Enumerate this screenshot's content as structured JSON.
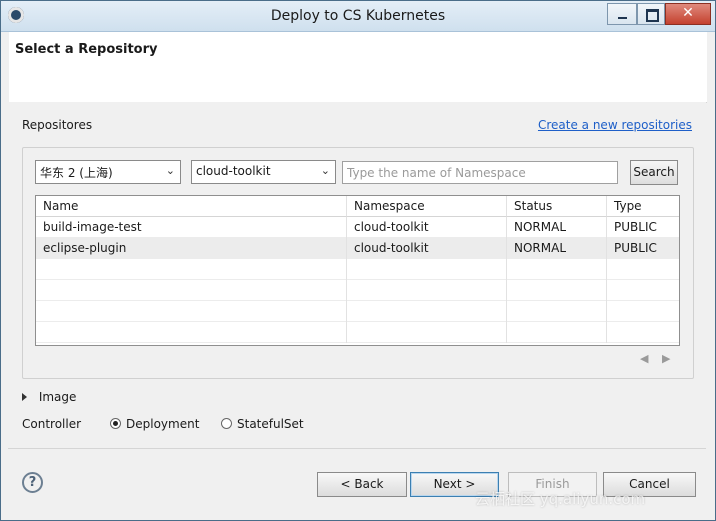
{
  "window": {
    "title": "Deploy to CS Kubernetes"
  },
  "header": {
    "title": "Select a Repository"
  },
  "repositories": {
    "label": "Repositores",
    "create_link": "Create a new repositories",
    "region_select": "华东 2 (上海)",
    "namespace_select": "cloud-toolkit",
    "namespace_placeholder": "Type the name of Namespace",
    "search_label": "Search",
    "columns": [
      "Name",
      "Namespace",
      "Status",
      "Type"
    ],
    "rows": [
      [
        "build-image-test",
        "cloud-toolkit",
        "NORMAL",
        "PUBLIC"
      ],
      [
        "eclipse-plugin",
        "cloud-toolkit",
        "NORMAL",
        "PUBLIC"
      ]
    ],
    "pager_prev": "◀",
    "pager_next": "▶"
  },
  "image_section": {
    "label": "Image"
  },
  "controller": {
    "label": "Controller",
    "options": [
      "Deployment",
      "StatefulSet"
    ],
    "selected": "Deployment"
  },
  "buttons": {
    "help": "?",
    "back": "< Back",
    "next": "Next >",
    "finish": "Finish",
    "cancel": "Cancel"
  },
  "watermark": "云栖社区 yq.aliyun.com",
  "icons": {
    "app": "eclipse-icon",
    "minimize": "minimize-icon",
    "maximize": "maximize-icon",
    "close": "close-icon",
    "dropdown": "chevron-down-icon",
    "help": "help-icon",
    "expand": "expand-triangle-icon"
  }
}
